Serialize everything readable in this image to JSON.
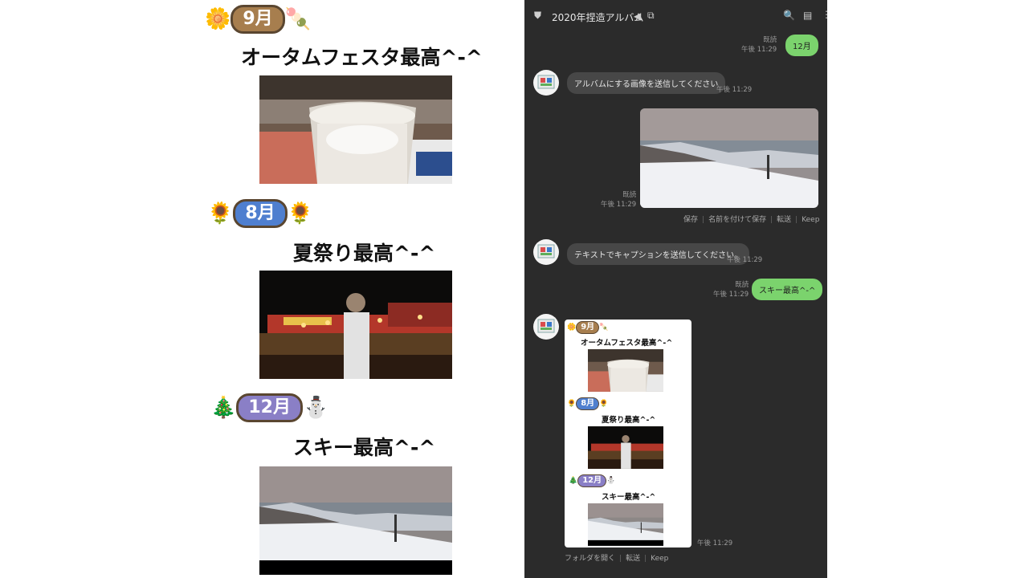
{
  "album": {
    "sections": [
      {
        "month": "9月",
        "caption": "オータムフェスタ最高^-^",
        "left_emoji": "🌼",
        "right_emoji": "🍡",
        "pill_color": "#a77e4e"
      },
      {
        "month": "8月",
        "caption": "夏祭り最高^-^",
        "left_emoji": "🌻",
        "right_emoji": "🌻",
        "pill_color": "#4f7fcf"
      },
      {
        "month": "12月",
        "caption": "スキー最高^-^",
        "left_emoji": "🎄",
        "right_emoji": "⛄",
        "pill_color": "#8a7fc6"
      }
    ]
  },
  "chat": {
    "title": "2020年捏造アルバム",
    "icons": {
      "shield": "shield-icon",
      "speaker": "speaker-icon",
      "copy": "copy-icon",
      "search": "search-icon",
      "notes": "notes-icon",
      "menu": "more-icon"
    },
    "messages": {
      "m1": {
        "text": "12月",
        "read": "既読",
        "time": "午後 11:29"
      },
      "m2": {
        "text": "アルバムにする画像を送信してください",
        "time": "午後 11:29"
      },
      "m3": {
        "read": "既読",
        "time": "午後 11:29",
        "actions": [
          "保存",
          "名前を付けて保存",
          "転送",
          "Keep"
        ]
      },
      "m4": {
        "text": "テキストでキャプションを送信してください。",
        "time": "午後 11:29"
      },
      "m5": {
        "text": "スキー最高^-^",
        "read": "既読",
        "time": "午後 11:29"
      },
      "m6": {
        "time": "午後 11:29",
        "actions": [
          "フォルダを開く",
          "転送",
          "Keep"
        ]
      }
    }
  },
  "colors": {
    "chat_bg": "#2b2b2b",
    "green_bubble": "#7bd36d",
    "gray_bubble": "#474747"
  }
}
